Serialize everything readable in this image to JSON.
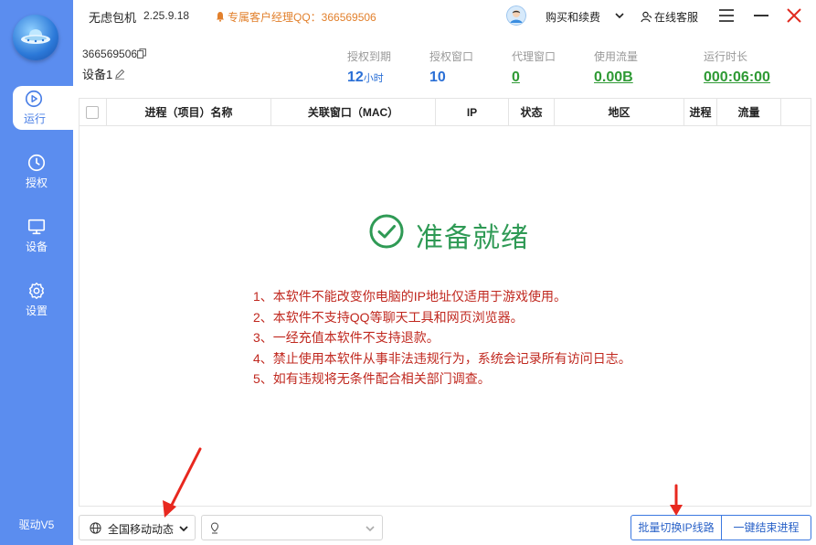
{
  "app": {
    "title": "无虑包机",
    "version": "2.25.9.18",
    "qq_contact": "专属客户经理QQ：366569506"
  },
  "header": {
    "buy_label": "购买和续费",
    "support_label": "在线客服"
  },
  "sidebar": {
    "items": [
      {
        "label": "运行",
        "icon": "play-circle-icon",
        "active": true
      },
      {
        "label": "授权",
        "icon": "clock-icon",
        "active": false
      },
      {
        "label": "设备",
        "icon": "monitor-icon",
        "active": false
      },
      {
        "label": "设置",
        "icon": "gear-icon",
        "active": false
      }
    ],
    "driver": "驱动V5"
  },
  "device": {
    "id": "366569506",
    "name": "设备1"
  },
  "stats": [
    {
      "label": "授权到期",
      "value": "12",
      "unit": "小时"
    },
    {
      "label": "授权窗口",
      "value": "10"
    },
    {
      "label": "代理窗口",
      "value": "0"
    },
    {
      "label": "使用流量",
      "value": "0.00B"
    },
    {
      "label": "运行时长",
      "value": "000:06:00"
    }
  ],
  "table": {
    "columns": [
      "进程（项目）名称",
      "关联窗口（MAC）",
      "IP",
      "状态",
      "地区",
      "进程",
      "流量"
    ]
  },
  "status": {
    "ready": "准备就绪"
  },
  "notices": [
    "1、本软件不能改变你电脑的IP地址仅适用于游戏使用。",
    "2、本软件不支持QQ等聊天工具和网页浏览器。",
    "3、一经充值本软件不支持退款。",
    "4、禁止使用本软件从事非法违规行为，系统会记录所有访问日志。",
    "5、如有违规将无条件配合相关部门调查。"
  ],
  "footer": {
    "region_select": "全国移动动态",
    "batch_switch": "批量切换IP线路",
    "end_all": "一键结束进程"
  },
  "colors": {
    "sidebar": "#5b8def",
    "ready": "#2f9a55",
    "notice": "#c0281f",
    "annotation": "#e8281f"
  }
}
